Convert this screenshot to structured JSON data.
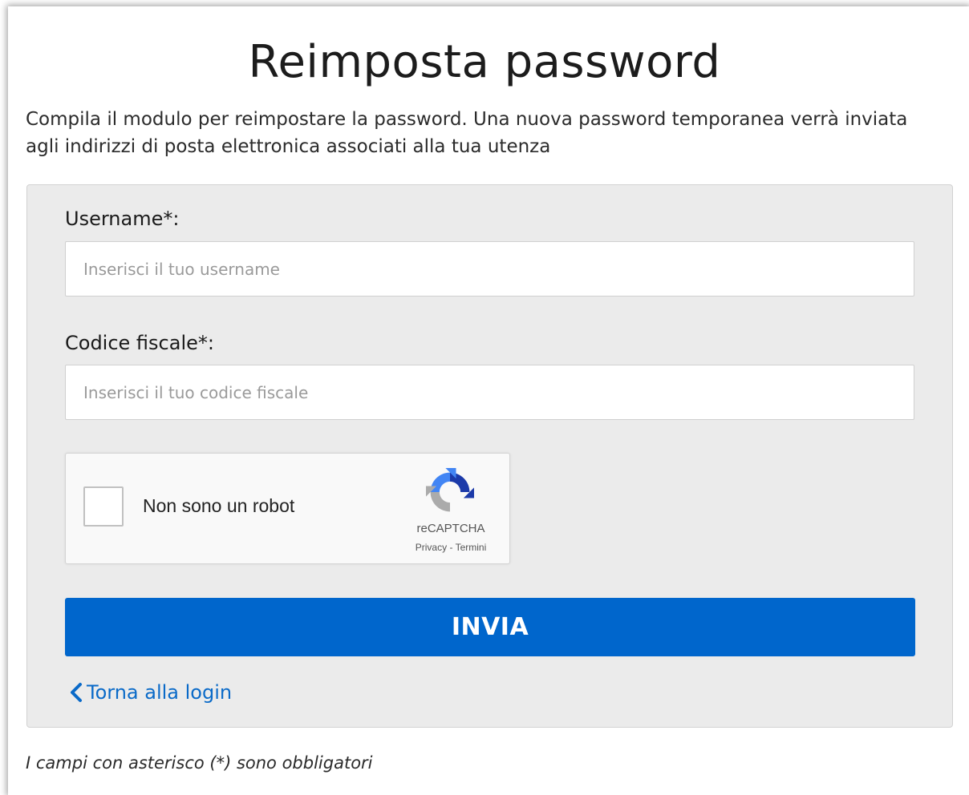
{
  "page": {
    "title": "Reimposta password",
    "intro": "Compila il modulo per reimpostare la password. Una nuova password temporanea verrà inviata agli indirizzi di posta elettronica associati alla tua utenza",
    "footnote": "I campi con asterisco (*) sono obbligatori"
  },
  "form": {
    "username_label": "Username*:",
    "username_placeholder": "Inserisci il tuo username",
    "username_value": "",
    "codice_label": "Codice fiscale*:",
    "codice_placeholder": "Inserisci il tuo codice fiscale",
    "codice_value": "",
    "submit_label": "INVIA",
    "back_label": "Torna alla login"
  },
  "captcha": {
    "label": "Non sono un robot",
    "brand": "reCAPTCHA",
    "privacy_link": "Privacy",
    "separator": " - ",
    "terms_link": "Termini",
    "checked": false,
    "icon": "recaptcha-logo"
  },
  "colors": {
    "primary": "#0066cc",
    "link": "#0a6ac8",
    "panel_background": "#ebebeb"
  }
}
